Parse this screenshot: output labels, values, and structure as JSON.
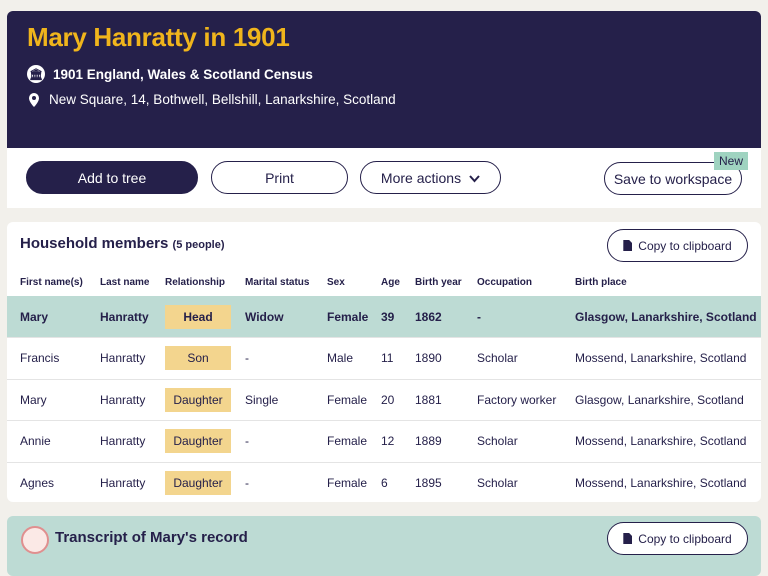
{
  "header": {
    "title": "Mary Hanratty in 1901",
    "collection": "1901 England, Wales & Scotland Census",
    "address": "New Square, 14, Bothwell, Bellshill, Lanarkshire, Scotland"
  },
  "actions": {
    "add_to_tree": "Add to tree",
    "print": "Print",
    "more_actions": "More actions",
    "save_to_workspace": "Save to workspace",
    "new_badge": "New"
  },
  "household": {
    "title": "Household members",
    "count": "(5 people)",
    "copy": "Copy to clipboard",
    "columns": [
      "First name(s)",
      "Last name",
      "Relationship",
      "Marital status",
      "Sex",
      "Age",
      "Birth year",
      "Occupation",
      "Birth place"
    ],
    "rows": [
      [
        "Mary",
        "Hanratty",
        "Head",
        "Widow",
        "Female",
        "39",
        "1862",
        "-",
        "Glasgow, Lanarkshire, Scotland"
      ],
      [
        "Francis",
        "Hanratty",
        "Son",
        "-",
        "Male",
        "11",
        "1890",
        "Scholar",
        "Mossend, Lanarkshire, Scotland"
      ],
      [
        "Mary",
        "Hanratty",
        "Daughter",
        "Single",
        "Female",
        "20",
        "1881",
        "Factory worker",
        "Glasgow, Lanarkshire, Scotland"
      ],
      [
        "Annie",
        "Hanratty",
        "Daughter",
        "-",
        "Female",
        "12",
        "1889",
        "Scholar",
        "Mossend, Lanarkshire, Scotland"
      ],
      [
        "Agnes",
        "Hanratty",
        "Daughter",
        "-",
        "Female",
        "6",
        "1895",
        "Scholar",
        "Mossend, Lanarkshire, Scotland"
      ]
    ]
  },
  "transcript": {
    "title": "Transcript of Mary's record",
    "copy": "Copy to clipboard"
  },
  "colors": {
    "navy": "#25204a",
    "gold": "#f0b51c",
    "highlight": "#bddbd4",
    "badge": "#f3d58e"
  }
}
